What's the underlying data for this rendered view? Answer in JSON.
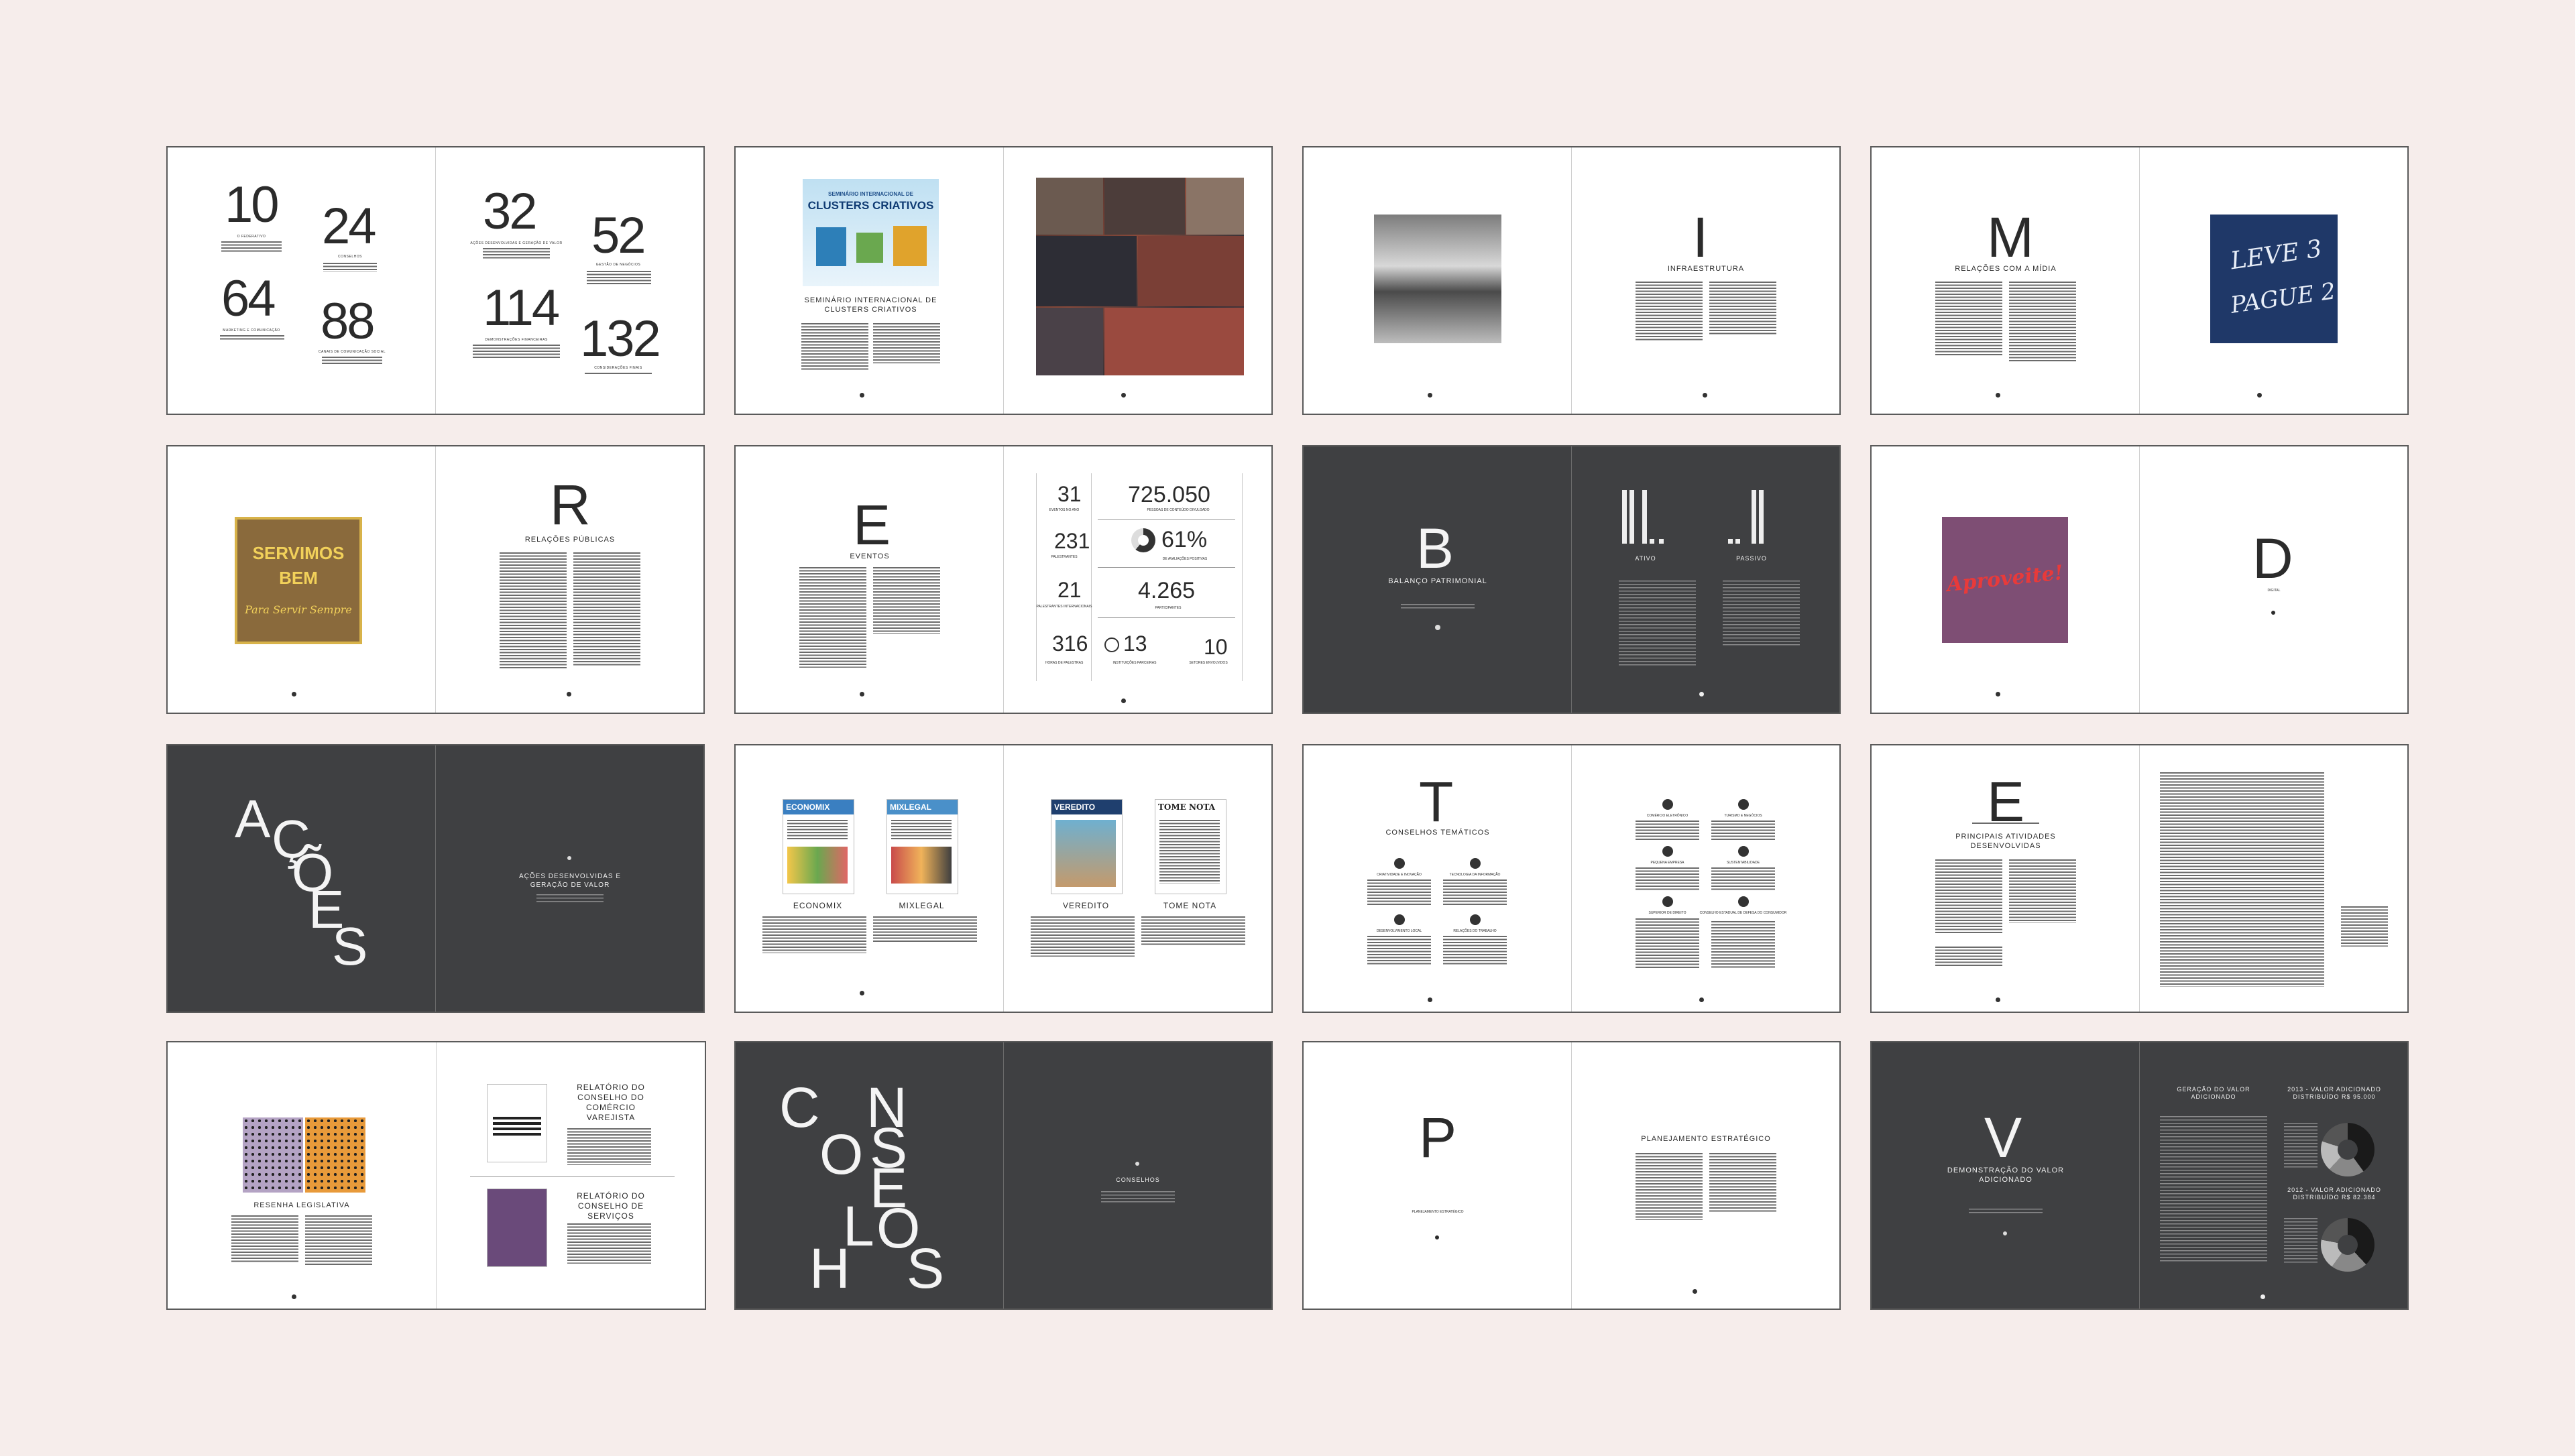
{
  "s1": {
    "n10": "10",
    "n24": "24",
    "n64": "64",
    "n88": "88",
    "n32": "32",
    "n52": "52",
    "n114": "114",
    "n132": "132",
    "l10": "O FEDERATIVO",
    "l24": "CONSELHOS",
    "l64": "MARKETING E COMUNICAÇÃO",
    "l88": "CANAIS DE COMUNICAÇÃO SOCIAL",
    "l32": "AÇÕES DESENVOLVIDAS E GERAÇÃO DE VALOR",
    "l52": "GESTÃO DE NEGÓCIOS",
    "l114": "DEMONSTRAÇÕES FINANCEIRAS",
    "l132": "CONSIDERAÇÕES FINAIS"
  },
  "s2": {
    "poster_line1": "SEMINÁRIO INTERNACIONAL DE",
    "poster_line2": "CLUSTERS CRIATIVOS",
    "title": "SEMINÁRIO INTERNACIONAL DE CLUSTERS CRIATIVOS"
  },
  "s3": {
    "letter": "I",
    "title": "INFRAESTRUTURA"
  },
  "s4": {
    "letter": "M",
    "title": "RELAÇÕES COM A MÍDIA",
    "ad_line1": "LEVE 3",
    "ad_line2": "PAGUE 2"
  },
  "s5": {
    "ad_line1": "SERVIMOS",
    "ad_line2": "BEM",
    "ad_line3": "Para Servir Sempre",
    "letter": "R",
    "title": "RELAÇÕES PÚBLICAS"
  },
  "s6": {
    "letter": "E",
    "title": "EVENTOS",
    "stats": {
      "n31": "31",
      "l31": "EVENTOS NO ANO",
      "n231": "231",
      "l231": "PALESTRANTES",
      "n21": "21",
      "l21": "PALESTRANTES INTERNACIONAIS",
      "n316": "316",
      "l316": "HORAS DE PALESTRAS",
      "n725": "725.050",
      "l725": "PESSOAS DE CONTEÚDO DIVULGADO",
      "n61": "61%",
      "l61": "DE AVALIAÇÕES POSITIVAS",
      "n4265": "4.265",
      "l4265": "PARTICIPANTES",
      "n13": "13",
      "l13": "INSTITUIÇÕES PARCEIRAS",
      "n10": "10",
      "l10": "SETORES ENVOLVIDOS"
    }
  },
  "s7": {
    "letter": "B",
    "title": "BALANÇO PATRIMONIAL",
    "ativo": "ATIVO",
    "passivo": "PASSIVO"
  },
  "s8": {
    "ad": "Aproveite!",
    "letter": "D",
    "sub": "DIGITAL"
  },
  "s9": {
    "a": "A",
    "c": "Ç",
    "o": "Õ",
    "e": "E",
    "s": "S",
    "title": "AÇÕES DESENVOLVIDAS E GERAÇÃO DE VALOR"
  },
  "s10": {
    "cover1": "ECONOMIX",
    "cover2": "MIXLEGAL",
    "cover3": "VEREDITO",
    "cover4": "TOME NOTA",
    "t1": "ECONOMIX",
    "t2": "MIXLEGAL",
    "t3": "VEREDITO",
    "t4": "TOME NOTA"
  },
  "s11": {
    "letter": "T",
    "title": "CONSELHOS TEMÁTICOS",
    "c1": "CRIATIVIDADE E INOVAÇÃO",
    "c2": "TECNOLOGIA DA INFORMAÇÃO",
    "c3": "DESENVOLVIMENTO LOCAL",
    "c4": "RELAÇÕES DO TRABALHO",
    "c5": "COMÉRCIO ELETRÔNICO",
    "c6": "TURISMO E NEGÓCIOS",
    "c7": "PEQUENA EMPRESA",
    "c8": "SUSTENTABILIDADE",
    "c9": "SUPERIOR DE DIREITO",
    "c10": "CONSELHO ESTADUAL DE DEFESA DO CONSUMIDOR"
  },
  "s12": {
    "letter": "E",
    "title": "PRINCIPAIS ATIVIDADES DESENVOLVIDAS"
  },
  "s13": {
    "title": "RESENHA LEGISLATIVA",
    "r1": "RELATÓRIO DO CONSELHO DO COMÉRCIO VAREJISTA",
    "r2": "RELATÓRIO DO CONSELHO DE SERVIÇOS"
  },
  "s14": {
    "c": "C",
    "o1": "O",
    "n": "N",
    "s": "S",
    "e": "E",
    "l": "L",
    "h": "H",
    "o2": "O",
    "s2": "S",
    "title": "CONSELHOS"
  },
  "s15": {
    "letter": "P",
    "sub": "PLANEJAMENTO ESTRATÉGICO",
    "title": "PLANEJAMENTO ESTRATÉGICO"
  },
  "s16": {
    "letter": "V",
    "title": "DEMONSTRAÇÃO DO VALOR ADICIONADO",
    "h1": "GERAÇÃO DO VALOR ADICIONADO",
    "h2": "2013 - VALOR ADICIONADO DISTRIBUÍDO R$ 95.000",
    "h3": "2012 - VALOR ADICIONADO DISTRIBUÍDO R$ 82.384"
  }
}
